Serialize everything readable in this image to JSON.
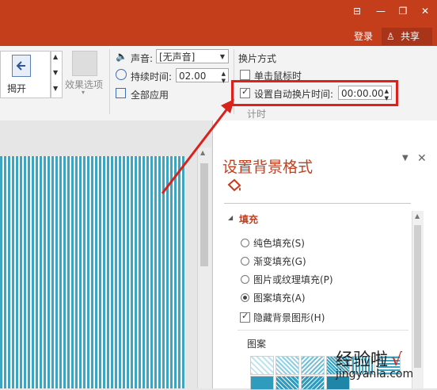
{
  "window": {
    "buttons": [
      "⊟",
      "—",
      "❐",
      "✕"
    ]
  },
  "account": {
    "login": "登录",
    "share": "共享"
  },
  "ribbon": {
    "effect_group": {
      "selected_effect": "揭开",
      "effect_options_label": "效果选项"
    },
    "timing": {
      "sound_label": "声音:",
      "sound_value": "[无声音]",
      "duration_label": "持续时间:",
      "duration_value": "02.00",
      "apply_all_label": "全部应用",
      "advance_title": "换片方式",
      "on_click_label": "单击鼠标时",
      "on_click_checked": false,
      "auto_after_label": "设置自动换片时间:",
      "auto_after_checked": true,
      "auto_after_value": "00:00.00",
      "group_name": "计时"
    }
  },
  "format_pane": {
    "title": "设置背景格式",
    "section": "填充",
    "options": [
      {
        "label": "纯色填充(S)",
        "selected": false
      },
      {
        "label": "渐变填充(G)",
        "selected": false
      },
      {
        "label": "图片或纹理填充(P)",
        "selected": false
      },
      {
        "label": "图案填充(A)",
        "selected": true
      }
    ],
    "hide_graphics_label": "隐藏背景图形(H)",
    "hide_graphics_checked": true,
    "pattern_label": "图案"
  },
  "watermark": {
    "main": "经验啦",
    "check": "√",
    "url": "jingyanla.com"
  },
  "colors": {
    "accent": "#c43e1c",
    "highlight": "#e0201b",
    "slide_stripe": "#3aa6c4"
  }
}
